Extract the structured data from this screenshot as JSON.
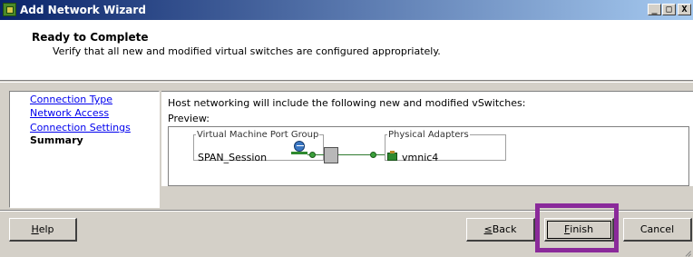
{
  "window": {
    "title": "Add Network Wizard",
    "controls": {
      "minimize": "_",
      "maximize": "□",
      "close": "X"
    }
  },
  "header": {
    "title": "Ready to Complete",
    "subtitle": "Verify that all new and modified virtual switches are configured appropriately."
  },
  "nav": {
    "items": [
      {
        "label": "Connection Type",
        "state": "link"
      },
      {
        "label": "Network Access",
        "state": "link"
      },
      {
        "label": "Connection Settings",
        "state": "link"
      },
      {
        "label": "Summary",
        "state": "current"
      }
    ]
  },
  "content": {
    "intro": "Host networking will include the following new and modified vSwitches:",
    "preview_label": "Preview:",
    "port_group": {
      "legend": "Virtual Machine Port Group",
      "name": "SPAN_Session"
    },
    "physical_adapters": {
      "legend": "Physical Adapters",
      "name": "vmnic4"
    }
  },
  "buttons": {
    "help": {
      "pre": "",
      "mnemonic": "H",
      "post": "elp"
    },
    "back": {
      "pre": "",
      "mnemonic": "≤",
      "post": " Back"
    },
    "finish": {
      "pre": "",
      "mnemonic": "F",
      "post": "inish"
    },
    "cancel": {
      "label": "Cancel"
    }
  },
  "colors": {
    "title_bar_start": "#0a246a",
    "title_bar_end": "#a6caf0",
    "link": "#0000ee",
    "highlight": "#8a2a9a",
    "dialog_bg": "#d4d0c8"
  }
}
